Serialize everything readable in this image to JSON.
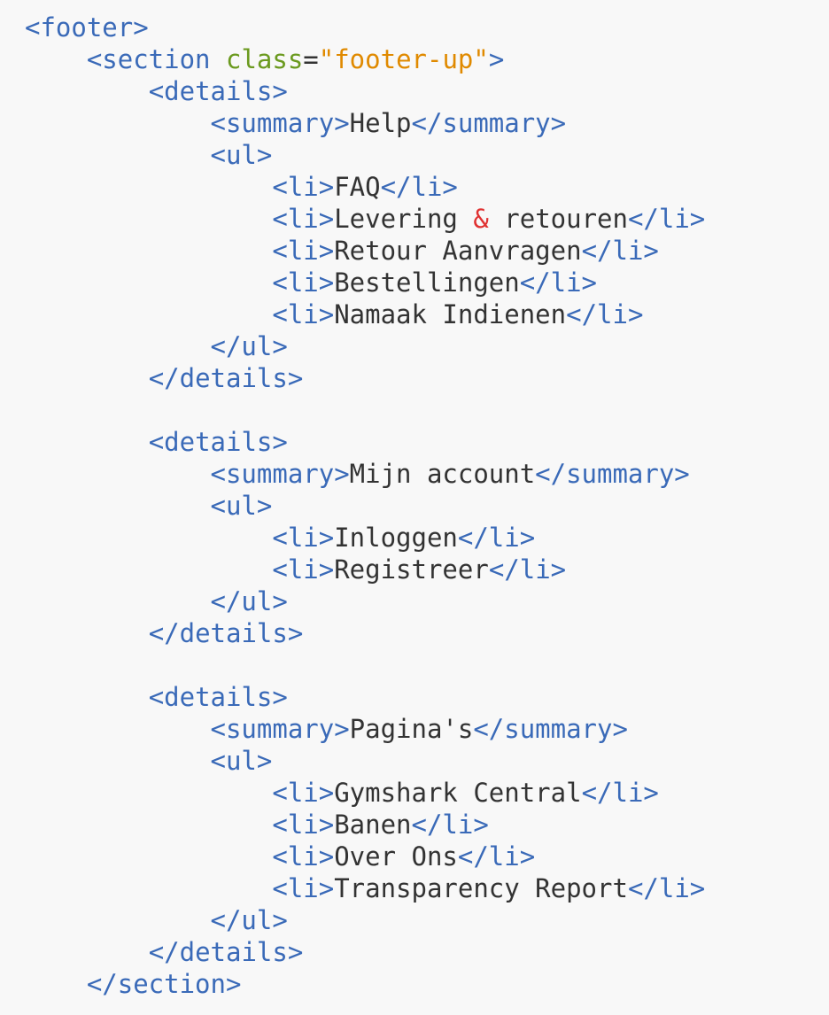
{
  "code_lines": [
    {
      "indent": 0,
      "tokens": [
        {
          "t": "tag",
          "v": "<footer>"
        }
      ]
    },
    {
      "indent": 1,
      "tokens": [
        {
          "t": "tag",
          "v": "<section "
        },
        {
          "t": "attr",
          "v": "class"
        },
        {
          "t": "eq",
          "v": "="
        },
        {
          "t": "str",
          "v": "\"footer-up\""
        },
        {
          "t": "tag",
          "v": ">"
        }
      ]
    },
    {
      "indent": 2,
      "tokens": [
        {
          "t": "tag",
          "v": "<details>"
        }
      ]
    },
    {
      "indent": 3,
      "tokens": [
        {
          "t": "tag",
          "v": "<summary>"
        },
        {
          "t": "txt",
          "v": "Help"
        },
        {
          "t": "tag",
          "v": "</summary>"
        }
      ]
    },
    {
      "indent": 3,
      "tokens": [
        {
          "t": "tag",
          "v": "<ul>"
        }
      ]
    },
    {
      "indent": 4,
      "tokens": [
        {
          "t": "tag",
          "v": "<li>"
        },
        {
          "t": "txt",
          "v": "FAQ"
        },
        {
          "t": "tag",
          "v": "</li>"
        }
      ]
    },
    {
      "indent": 4,
      "tokens": [
        {
          "t": "tag",
          "v": "<li>"
        },
        {
          "t": "txt",
          "v": "Levering "
        },
        {
          "t": "ent",
          "v": "&"
        },
        {
          "t": "txt",
          "v": " retouren"
        },
        {
          "t": "tag",
          "v": "</li>"
        }
      ]
    },
    {
      "indent": 4,
      "tokens": [
        {
          "t": "tag",
          "v": "<li>"
        },
        {
          "t": "txt",
          "v": "Retour Aanvragen"
        },
        {
          "t": "tag",
          "v": "</li>"
        }
      ]
    },
    {
      "indent": 4,
      "tokens": [
        {
          "t": "tag",
          "v": "<li>"
        },
        {
          "t": "txt",
          "v": "Bestellingen"
        },
        {
          "t": "tag",
          "v": "</li>"
        }
      ]
    },
    {
      "indent": 4,
      "tokens": [
        {
          "t": "tag",
          "v": "<li>"
        },
        {
          "t": "txt",
          "v": "Namaak Indienen"
        },
        {
          "t": "tag",
          "v": "</li>"
        }
      ]
    },
    {
      "indent": 3,
      "tokens": [
        {
          "t": "tag",
          "v": "</ul>"
        }
      ]
    },
    {
      "indent": 2,
      "tokens": [
        {
          "t": "tag",
          "v": "</details>"
        }
      ]
    },
    {
      "indent": 0,
      "tokens": []
    },
    {
      "indent": 2,
      "tokens": [
        {
          "t": "tag",
          "v": "<details>"
        }
      ]
    },
    {
      "indent": 3,
      "tokens": [
        {
          "t": "tag",
          "v": "<summary>"
        },
        {
          "t": "txt",
          "v": "Mijn account"
        },
        {
          "t": "tag",
          "v": "</summary>"
        }
      ]
    },
    {
      "indent": 3,
      "tokens": [
        {
          "t": "tag",
          "v": "<ul>"
        }
      ]
    },
    {
      "indent": 4,
      "tokens": [
        {
          "t": "tag",
          "v": "<li>"
        },
        {
          "t": "txt",
          "v": "Inloggen"
        },
        {
          "t": "tag",
          "v": "</li>"
        }
      ]
    },
    {
      "indent": 4,
      "tokens": [
        {
          "t": "tag",
          "v": "<li>"
        },
        {
          "t": "txt",
          "v": "Registreer"
        },
        {
          "t": "tag",
          "v": "</li>"
        }
      ]
    },
    {
      "indent": 3,
      "tokens": [
        {
          "t": "tag",
          "v": "</ul>"
        }
      ]
    },
    {
      "indent": 2,
      "tokens": [
        {
          "t": "tag",
          "v": "</details>"
        }
      ]
    },
    {
      "indent": 0,
      "tokens": []
    },
    {
      "indent": 2,
      "tokens": [
        {
          "t": "tag",
          "v": "<details>"
        }
      ]
    },
    {
      "indent": 3,
      "tokens": [
        {
          "t": "tag",
          "v": "<summary>"
        },
        {
          "t": "txt",
          "v": "Pagina's"
        },
        {
          "t": "tag",
          "v": "</summary>"
        }
      ]
    },
    {
      "indent": 3,
      "tokens": [
        {
          "t": "tag",
          "v": "<ul>"
        }
      ]
    },
    {
      "indent": 4,
      "tokens": [
        {
          "t": "tag",
          "v": "<li>"
        },
        {
          "t": "txt",
          "v": "Gymshark Central"
        },
        {
          "t": "tag",
          "v": "</li>"
        }
      ]
    },
    {
      "indent": 4,
      "tokens": [
        {
          "t": "tag",
          "v": "<li>"
        },
        {
          "t": "txt",
          "v": "Banen"
        },
        {
          "t": "tag",
          "v": "</li>"
        }
      ]
    },
    {
      "indent": 4,
      "tokens": [
        {
          "t": "tag",
          "v": "<li>"
        },
        {
          "t": "txt",
          "v": "Over Ons"
        },
        {
          "t": "tag",
          "v": "</li>"
        }
      ]
    },
    {
      "indent": 4,
      "tokens": [
        {
          "t": "tag",
          "v": "<li>"
        },
        {
          "t": "txt",
          "v": "Transparency Report"
        },
        {
          "t": "tag",
          "v": "</li>"
        }
      ]
    },
    {
      "indent": 3,
      "tokens": [
        {
          "t": "tag",
          "v": "</ul>"
        }
      ]
    },
    {
      "indent": 2,
      "tokens": [
        {
          "t": "tag",
          "v": "</details>"
        }
      ]
    },
    {
      "indent": 1,
      "tokens": [
        {
          "t": "tag",
          "v": "</section>"
        }
      ]
    }
  ],
  "colors": {
    "background": "#f8f8f8",
    "tag": "#3a6ab8",
    "attribute": "#6b9a1f",
    "string": "#e08a00",
    "entity": "#e03131",
    "text": "#333333"
  }
}
